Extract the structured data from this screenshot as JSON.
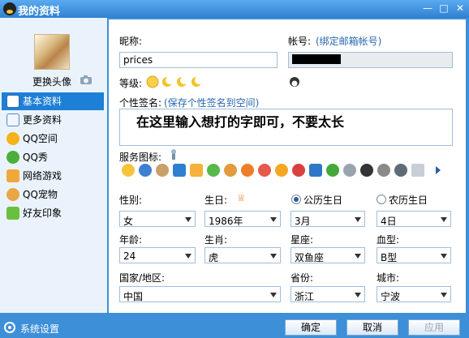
{
  "window": {
    "title": "我的资料",
    "min": "—",
    "max": "□",
    "close": "✕"
  },
  "sidebar": {
    "change_avatar": "更换头像",
    "items": [
      {
        "label": "基本资料"
      },
      {
        "label": "更多资料"
      },
      {
        "label": "QQ空间"
      },
      {
        "label": "QQ秀"
      },
      {
        "label": "网络游戏"
      },
      {
        "label": "QQ宠物"
      },
      {
        "label": "好友印象"
      }
    ],
    "system_settings": "系统设置"
  },
  "form": {
    "nickname_label": "昵称:",
    "nickname": "prices",
    "account_label": "帐号:",
    "account_link": "(绑定邮箱帐号)",
    "level_label": "等级:",
    "signature_label": "个性签名:",
    "signature_link": "(保存个性签名到空间)",
    "signature": "在这里输入想打的字即可，不要太长",
    "service_label": "服务图标:",
    "gender_label": "性别:",
    "gender": "女",
    "birthday_label": "生日:",
    "birth_year": "1986年",
    "solar_label": "公历生日",
    "lunar_label": "农历生日",
    "birth_month": "3月",
    "birth_day": "4日",
    "age_label": "年龄:",
    "age": "24",
    "zodiac_label": "生肖:",
    "zodiac": "虎",
    "constellation_label": "星座:",
    "constellation": "双鱼座",
    "blood_label": "血型:",
    "blood": "B型",
    "country_label": "国家/地区:",
    "country": "中国",
    "province_label": "省份:",
    "province": "浙江",
    "city_label": "城市:",
    "city": "宁波"
  },
  "footer": {
    "ok": "确定",
    "cancel": "取消",
    "apply": "应用"
  }
}
